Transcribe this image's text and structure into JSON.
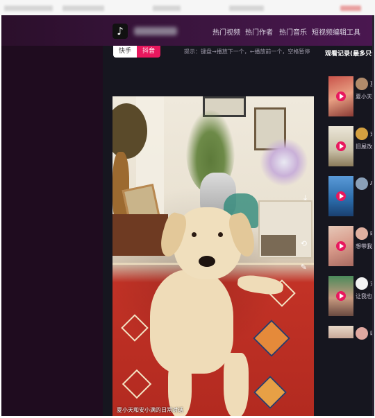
{
  "header": {
    "logo_glyph": "♪",
    "nav": [
      "热门视频",
      "热门作者",
      "热门音乐",
      "短视频编辑工具"
    ]
  },
  "main": {
    "toggle": [
      "快手",
      "抖音"
    ],
    "hint": "提示：键盘→播放下一个，←播放前一个，空格暂停",
    "video_caption": "夏小天和安小满的日常对话",
    "icons": [
      "download-icon",
      "loop-icon",
      "wrench-icon"
    ]
  },
  "history": {
    "title": "观看记录(最多只保",
    "items": [
      {
        "user": "夏",
        "title": "夏小天和"
      },
      {
        "user": "宠",
        "title": "旧屋改造"
      },
      {
        "user": "A",
        "title": ""
      },
      {
        "user": "明",
        "title": "想带我家"
      },
      {
        "user": "宠",
        "title": "让我也火"
      },
      {
        "user": "明",
        "title": ""
      }
    ]
  },
  "colors": {
    "accent": "#e8185e",
    "header_start": "#2b0f2b",
    "header_end": "#4a1750",
    "page_bg": "#16161f"
  }
}
